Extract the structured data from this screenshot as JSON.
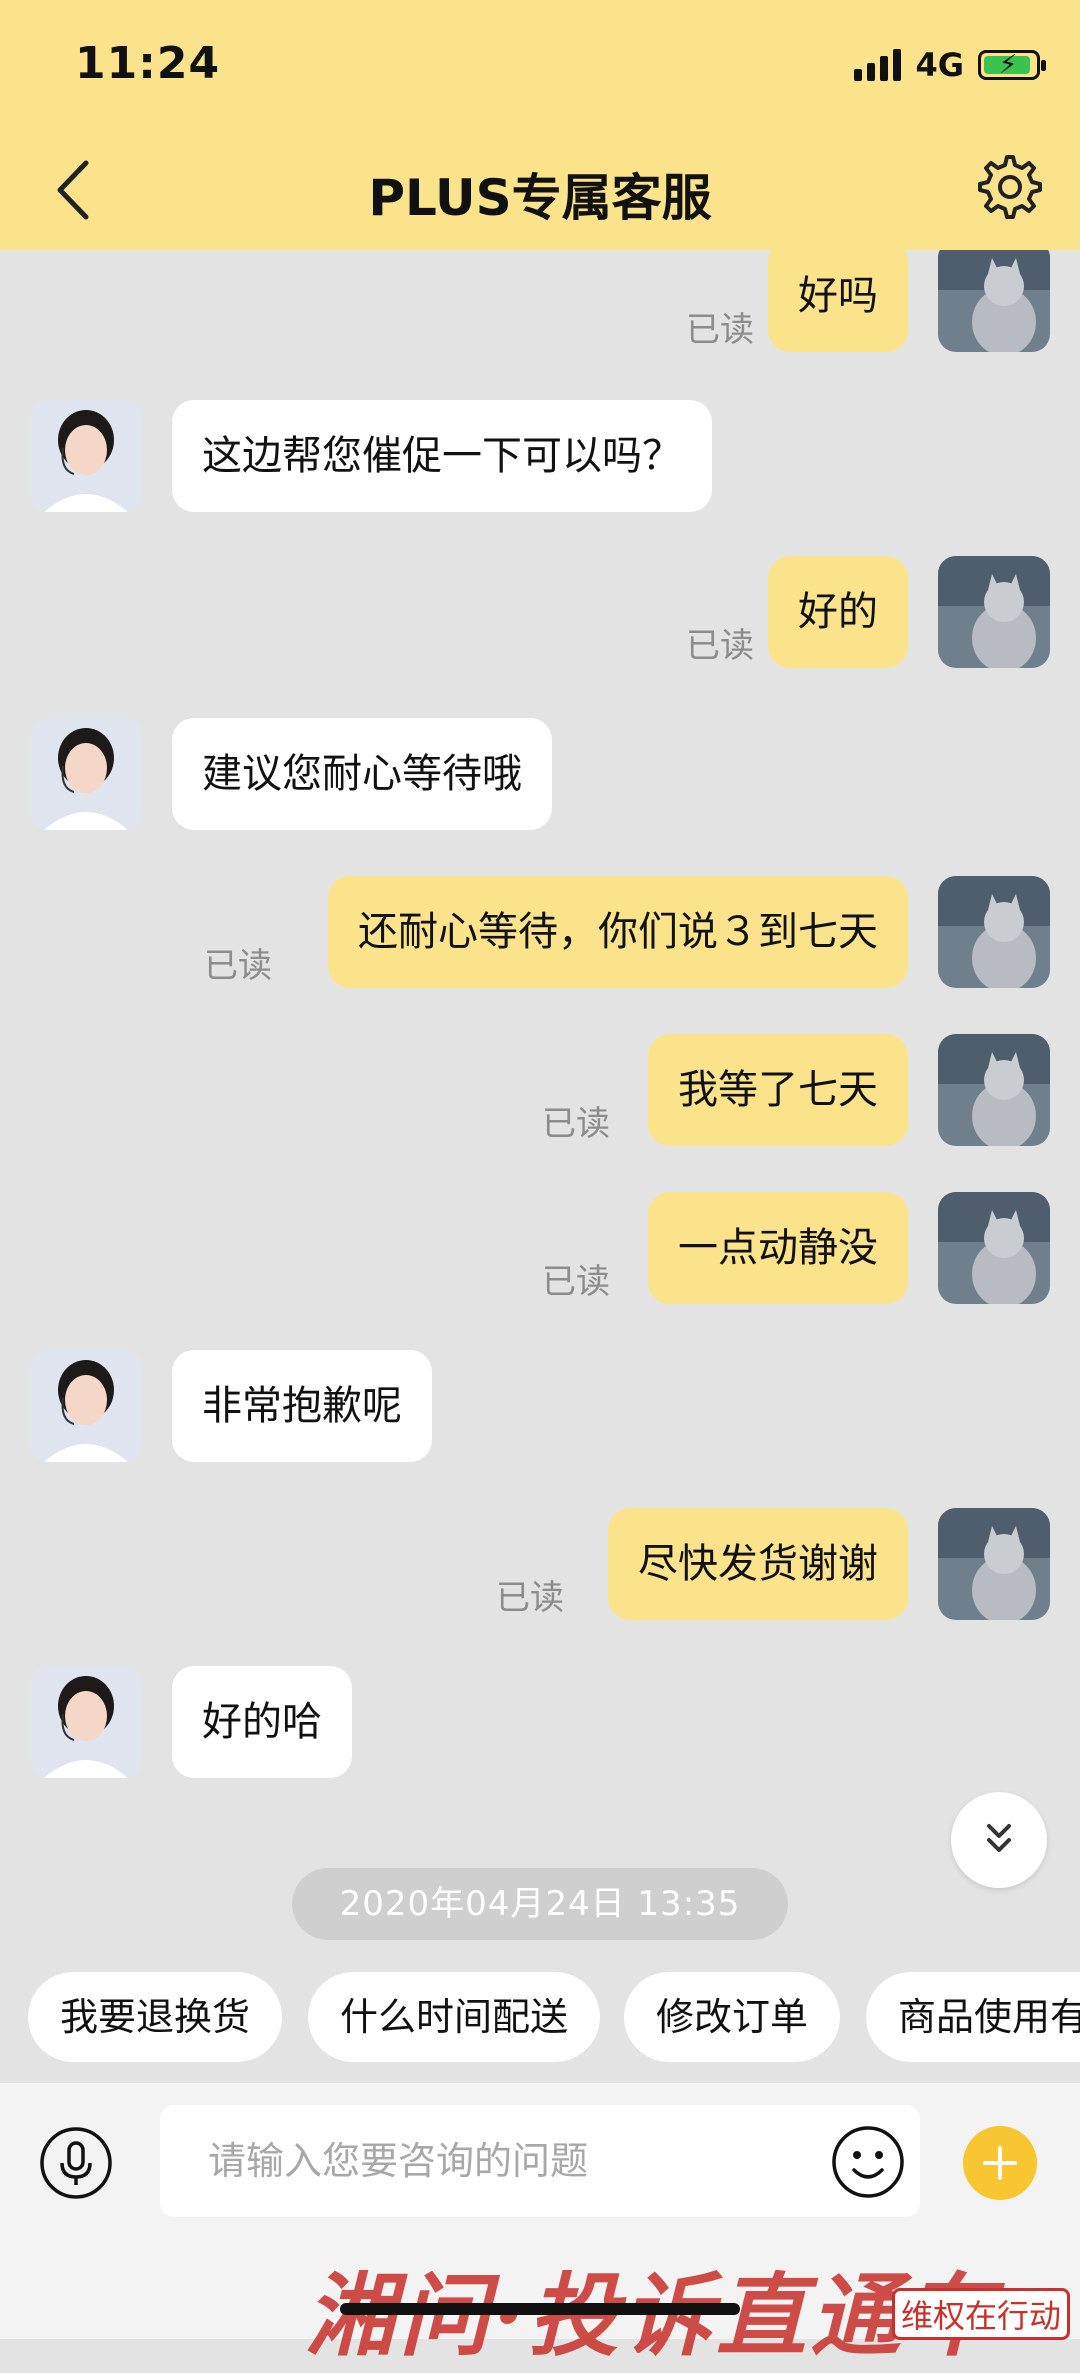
{
  "status_bar": {
    "time": "11:24",
    "network": "4G"
  },
  "header": {
    "title": "PLUS专属客服",
    "back_icon": "chevron-left-icon",
    "settings_icon": "gear-icon"
  },
  "messages": [
    {
      "sender": "user",
      "text": "好吗",
      "status": "已读"
    },
    {
      "sender": "agent",
      "text": "这边帮您催促一下可以吗？"
    },
    {
      "sender": "user",
      "text": "好的",
      "status": "已读"
    },
    {
      "sender": "agent",
      "text": "建议您耐心等待哦"
    },
    {
      "sender": "user",
      "text": "还耐心等待，你们说３到七天",
      "status": "已读"
    },
    {
      "sender": "user",
      "text": "我等了七天",
      "status": "已读"
    },
    {
      "sender": "user",
      "text": "一点动静没",
      "status": "已读"
    },
    {
      "sender": "agent",
      "text": "非常抱歉呢"
    },
    {
      "sender": "user",
      "text": "尽快发货谢谢",
      "status": "已读"
    },
    {
      "sender": "agent",
      "text": "好的哈"
    }
  ],
  "timestamp": "2020年04月24日 13:35",
  "quick_replies": [
    "我要退换货",
    "什么时间配送",
    "修改订单",
    "商品使用有"
  ],
  "input": {
    "placeholder": "请输入您要咨询的问题"
  },
  "watermark": {
    "main": "湘问·投诉直通车",
    "stamp": "维权在行动"
  },
  "colors": {
    "header_bg": "#fbe38c",
    "my_bubble": "#fbe38c",
    "their_bubble": "#ffffff",
    "chat_bg": "#e3e3e3",
    "plus_button": "#f8c631"
  }
}
